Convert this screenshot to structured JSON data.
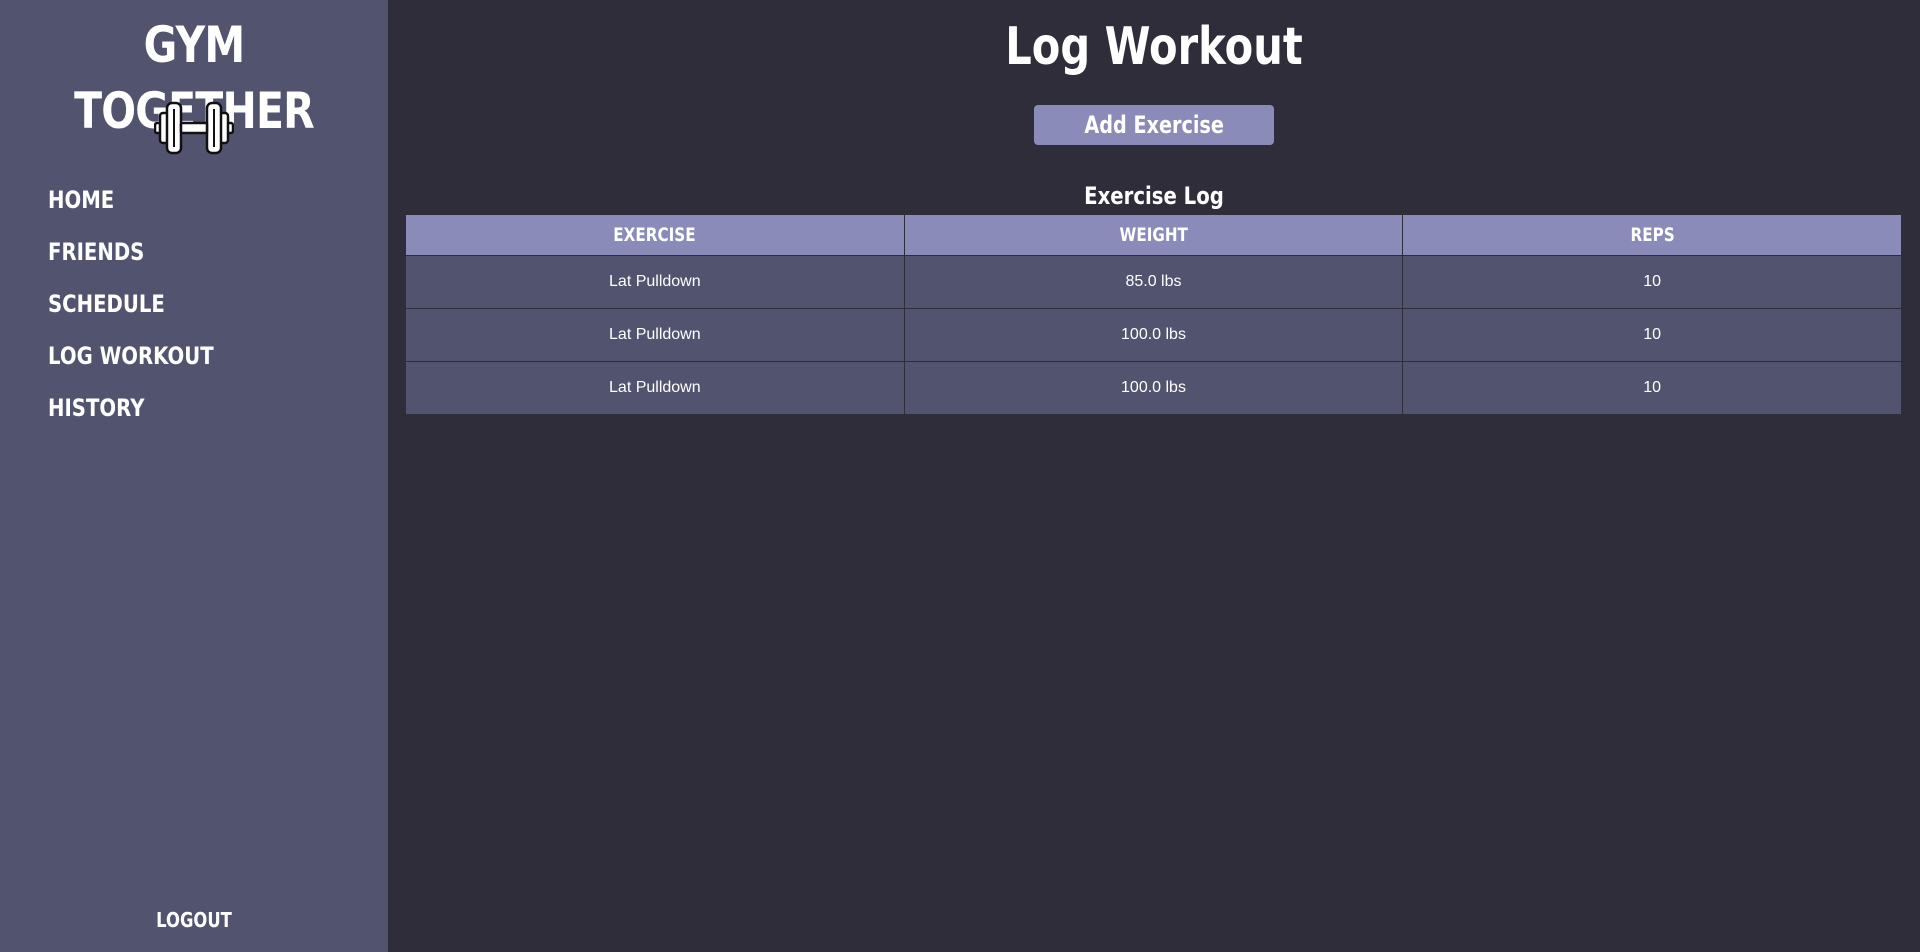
{
  "sidebar": {
    "brand": "GYM TOGETHER",
    "logo_icon": "dumbbell-icon",
    "nav": [
      {
        "label": "HOME"
      },
      {
        "label": "FRIENDS"
      },
      {
        "label": "SCHEDULE"
      },
      {
        "label": "LOG WORKOUT"
      },
      {
        "label": "HISTORY"
      }
    ],
    "logout_label": "LOGOUT"
  },
  "main": {
    "title": "Log Workout",
    "add_button_label": "Add Exercise",
    "log_title": "Exercise Log",
    "table": {
      "headers": [
        "EXERCISE",
        "WEIGHT",
        "REPS"
      ],
      "rows": [
        [
          "Lat Pulldown",
          "85.0 lbs",
          "10"
        ],
        [
          "Lat Pulldown",
          "100.0 lbs",
          "10"
        ],
        [
          "Lat Pulldown",
          "100.0 lbs",
          "10"
        ]
      ]
    }
  },
  "colors": {
    "background": "#2e2d39",
    "sidebar": "#52536f",
    "accent": "#8a8bb8",
    "text": "#ffffff"
  }
}
